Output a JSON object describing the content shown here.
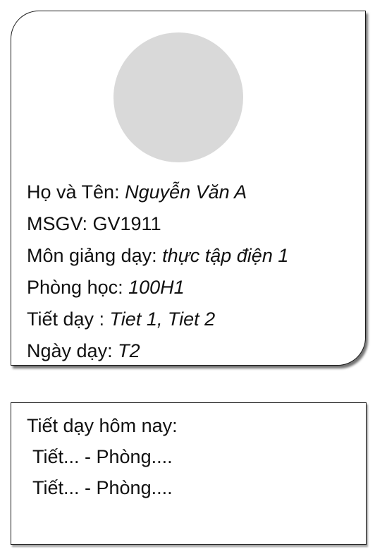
{
  "profile": {
    "avatar": "user-avatar-placeholder",
    "fields": [
      {
        "label": "Họ và Tên: ",
        "value": "Nguyễn Văn A"
      },
      {
        "label": "MSGV: GV1911",
        "value": ""
      },
      {
        "label": "Môn giảng dạy: ",
        "value": "thực tập điện 1"
      },
      {
        "label": "Phòng học: ",
        "value": "100H1"
      },
      {
        "label": "Tiết dạy : ",
        "value": "Tiet 1, Tiet 2"
      },
      {
        "label": "Ngày dạy: ",
        "value": "T2"
      }
    ]
  },
  "schedule": {
    "title": "Tiết dạy hôm nay:",
    "items": [
      "Tiết... - Phòng....",
      "Tiết... - Phòng...."
    ]
  },
  "colors": {
    "avatar": "#d9d9d9",
    "border": "#1a1a1a",
    "text": "#111111"
  }
}
